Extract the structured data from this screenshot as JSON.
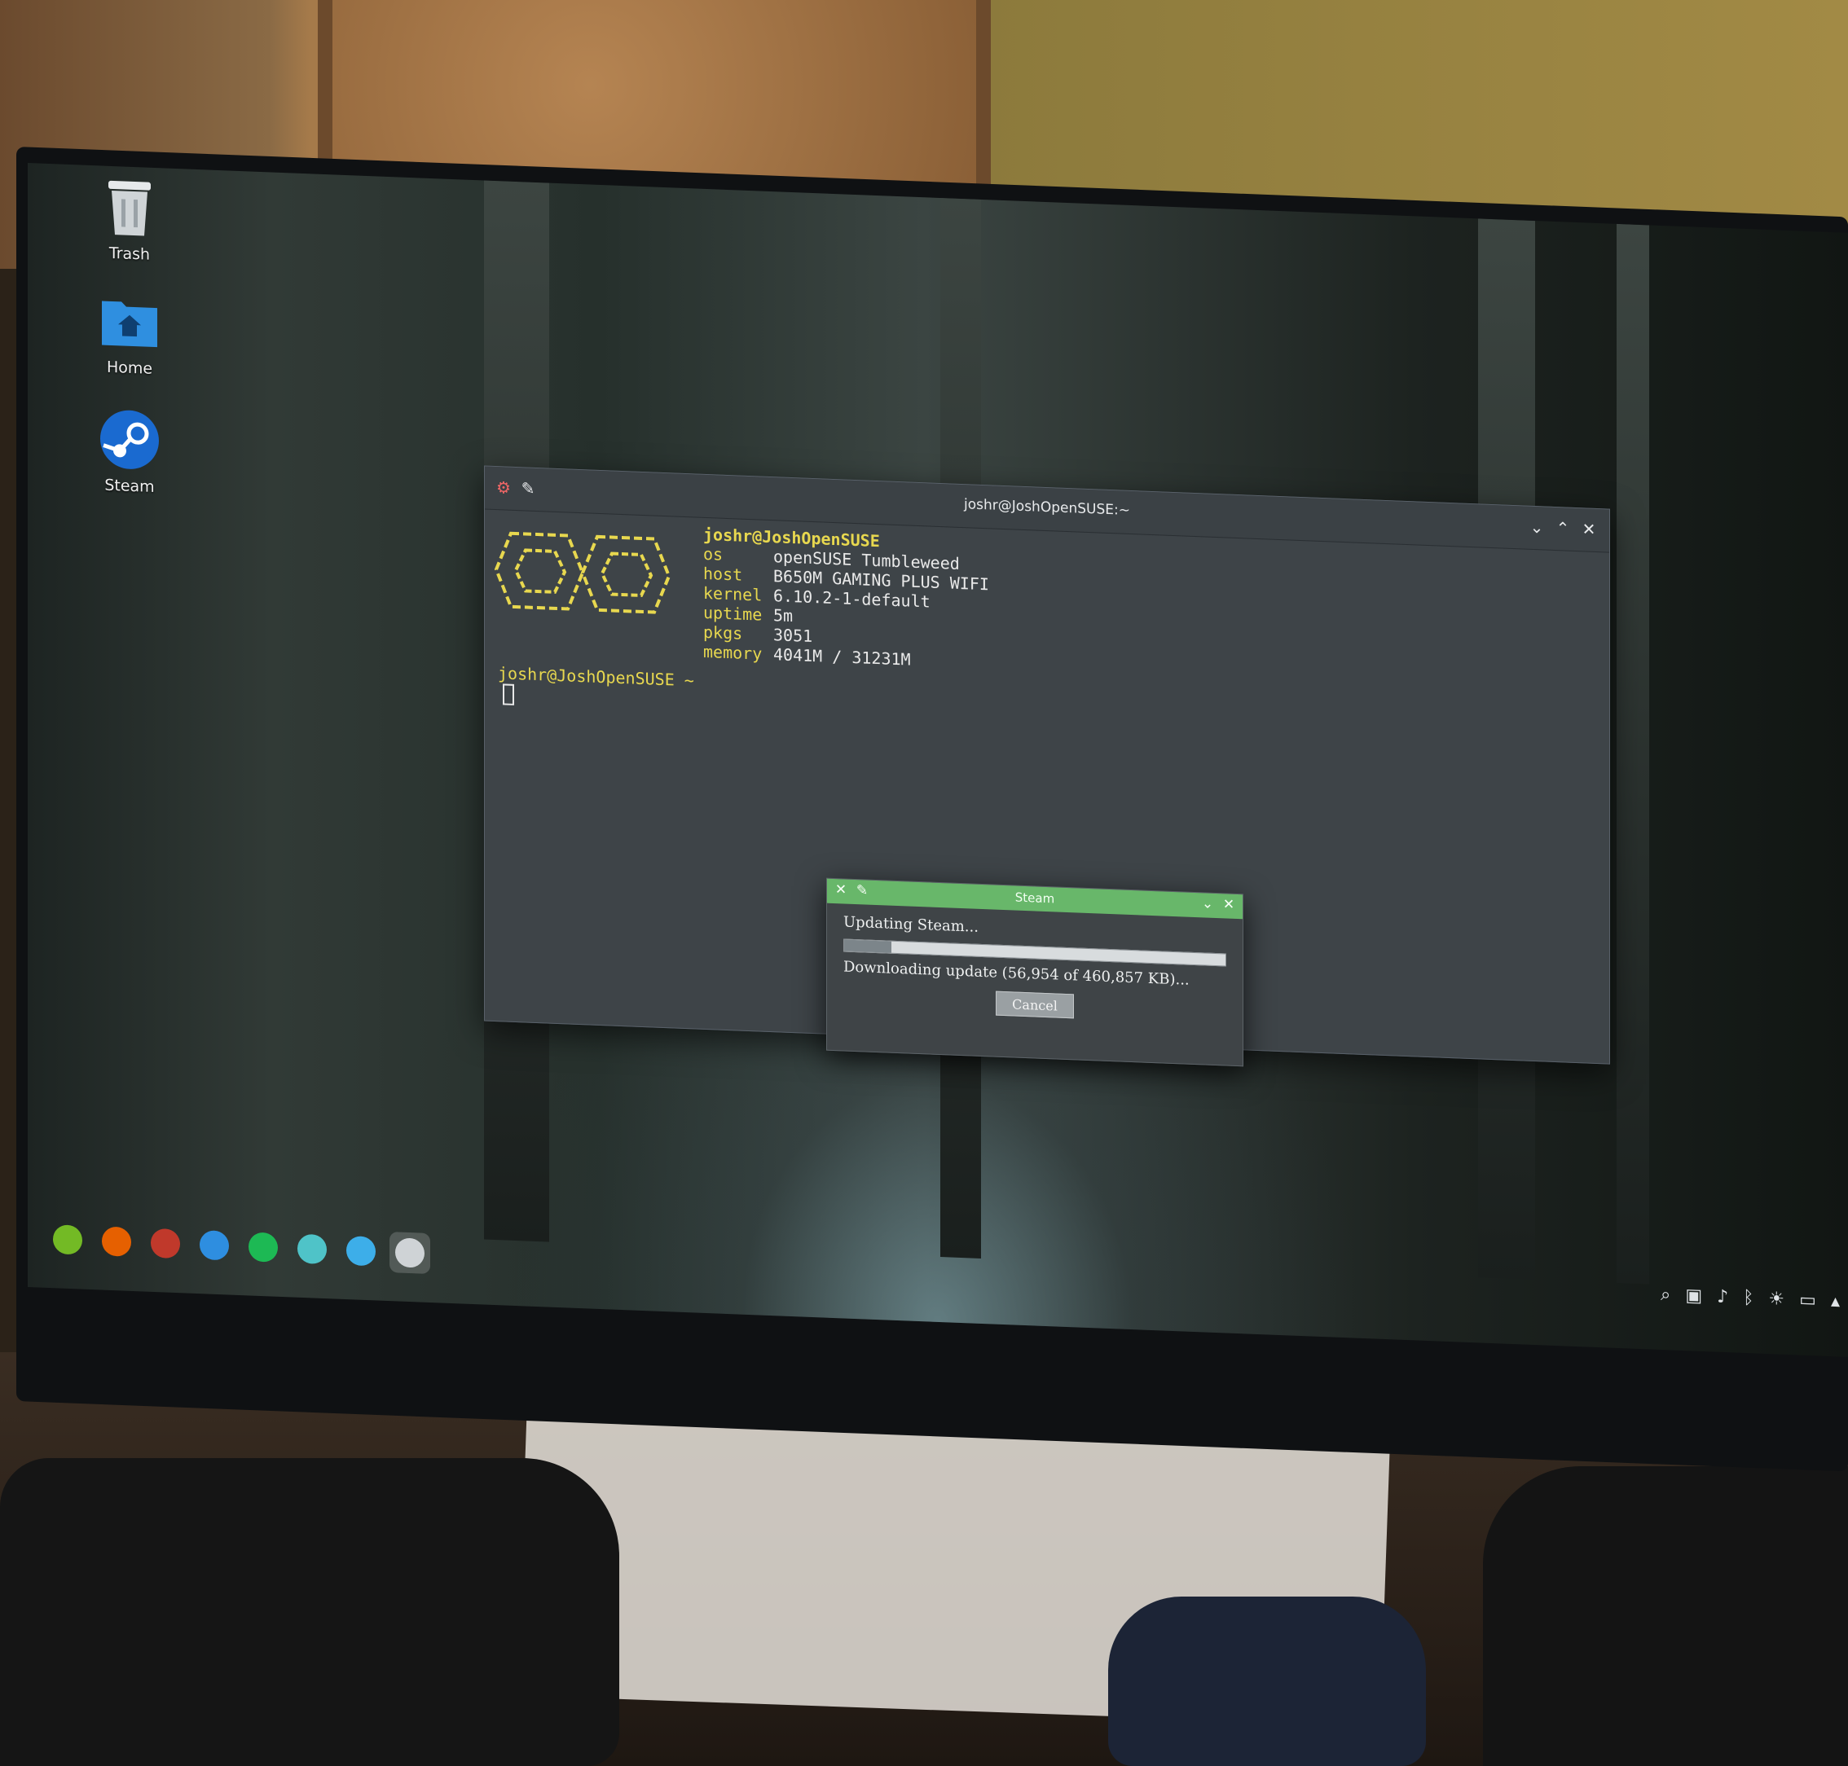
{
  "desktop": {
    "icons": [
      {
        "label": "Trash",
        "icon": "trash-icon"
      },
      {
        "label": "Home",
        "icon": "home-folder-icon"
      },
      {
        "label": "Steam",
        "icon": "steam-icon"
      }
    ]
  },
  "terminal": {
    "title": "joshr@JoshOpenSUSE:~",
    "fetch_header": "joshr@JoshOpenSUSE",
    "rows": [
      {
        "key": "os",
        "value": "openSUSE Tumbleweed"
      },
      {
        "key": "host",
        "value": "B650M GAMING PLUS WIFI"
      },
      {
        "key": "kernel",
        "value": "6.10.2-1-default"
      },
      {
        "key": "uptime",
        "value": "5m"
      },
      {
        "key": "pkgs",
        "value": "3051"
      },
      {
        "key": "memory",
        "value": "4041M / 31231M"
      }
    ],
    "prompt": "joshr@JoshOpenSUSE ~",
    "accent_color": "#e8d84f"
  },
  "steam_dialog": {
    "title": "Steam",
    "status": "Updating Steam...",
    "detail": "Downloading update (56,954 of 460,857 KB)...",
    "progress": 0.124,
    "cancel_label": "Cancel",
    "titlebar_color": "#68b76a"
  },
  "taskbar": {
    "items": [
      {
        "name": "opensuse-menu-icon",
        "color": "#73ba25"
      },
      {
        "name": "firefox-icon",
        "color": "#e66000"
      },
      {
        "name": "app-icon",
        "color": "#c0392b"
      },
      {
        "name": "file-manager-icon",
        "color": "#2e8ee0"
      },
      {
        "name": "spotify-icon",
        "color": "#1db954"
      },
      {
        "name": "app-icon",
        "color": "#4fc3c8"
      },
      {
        "name": "discover-icon",
        "color": "#3daee9"
      },
      {
        "name": "terminal-icon",
        "color": "#cfd3d6"
      }
    ]
  },
  "tray": {
    "icons": [
      "search-icon",
      "window-icon",
      "volume-icon",
      "bluetooth-icon",
      "brightness-icon",
      "battery-icon",
      "chevron-up-icon"
    ]
  }
}
